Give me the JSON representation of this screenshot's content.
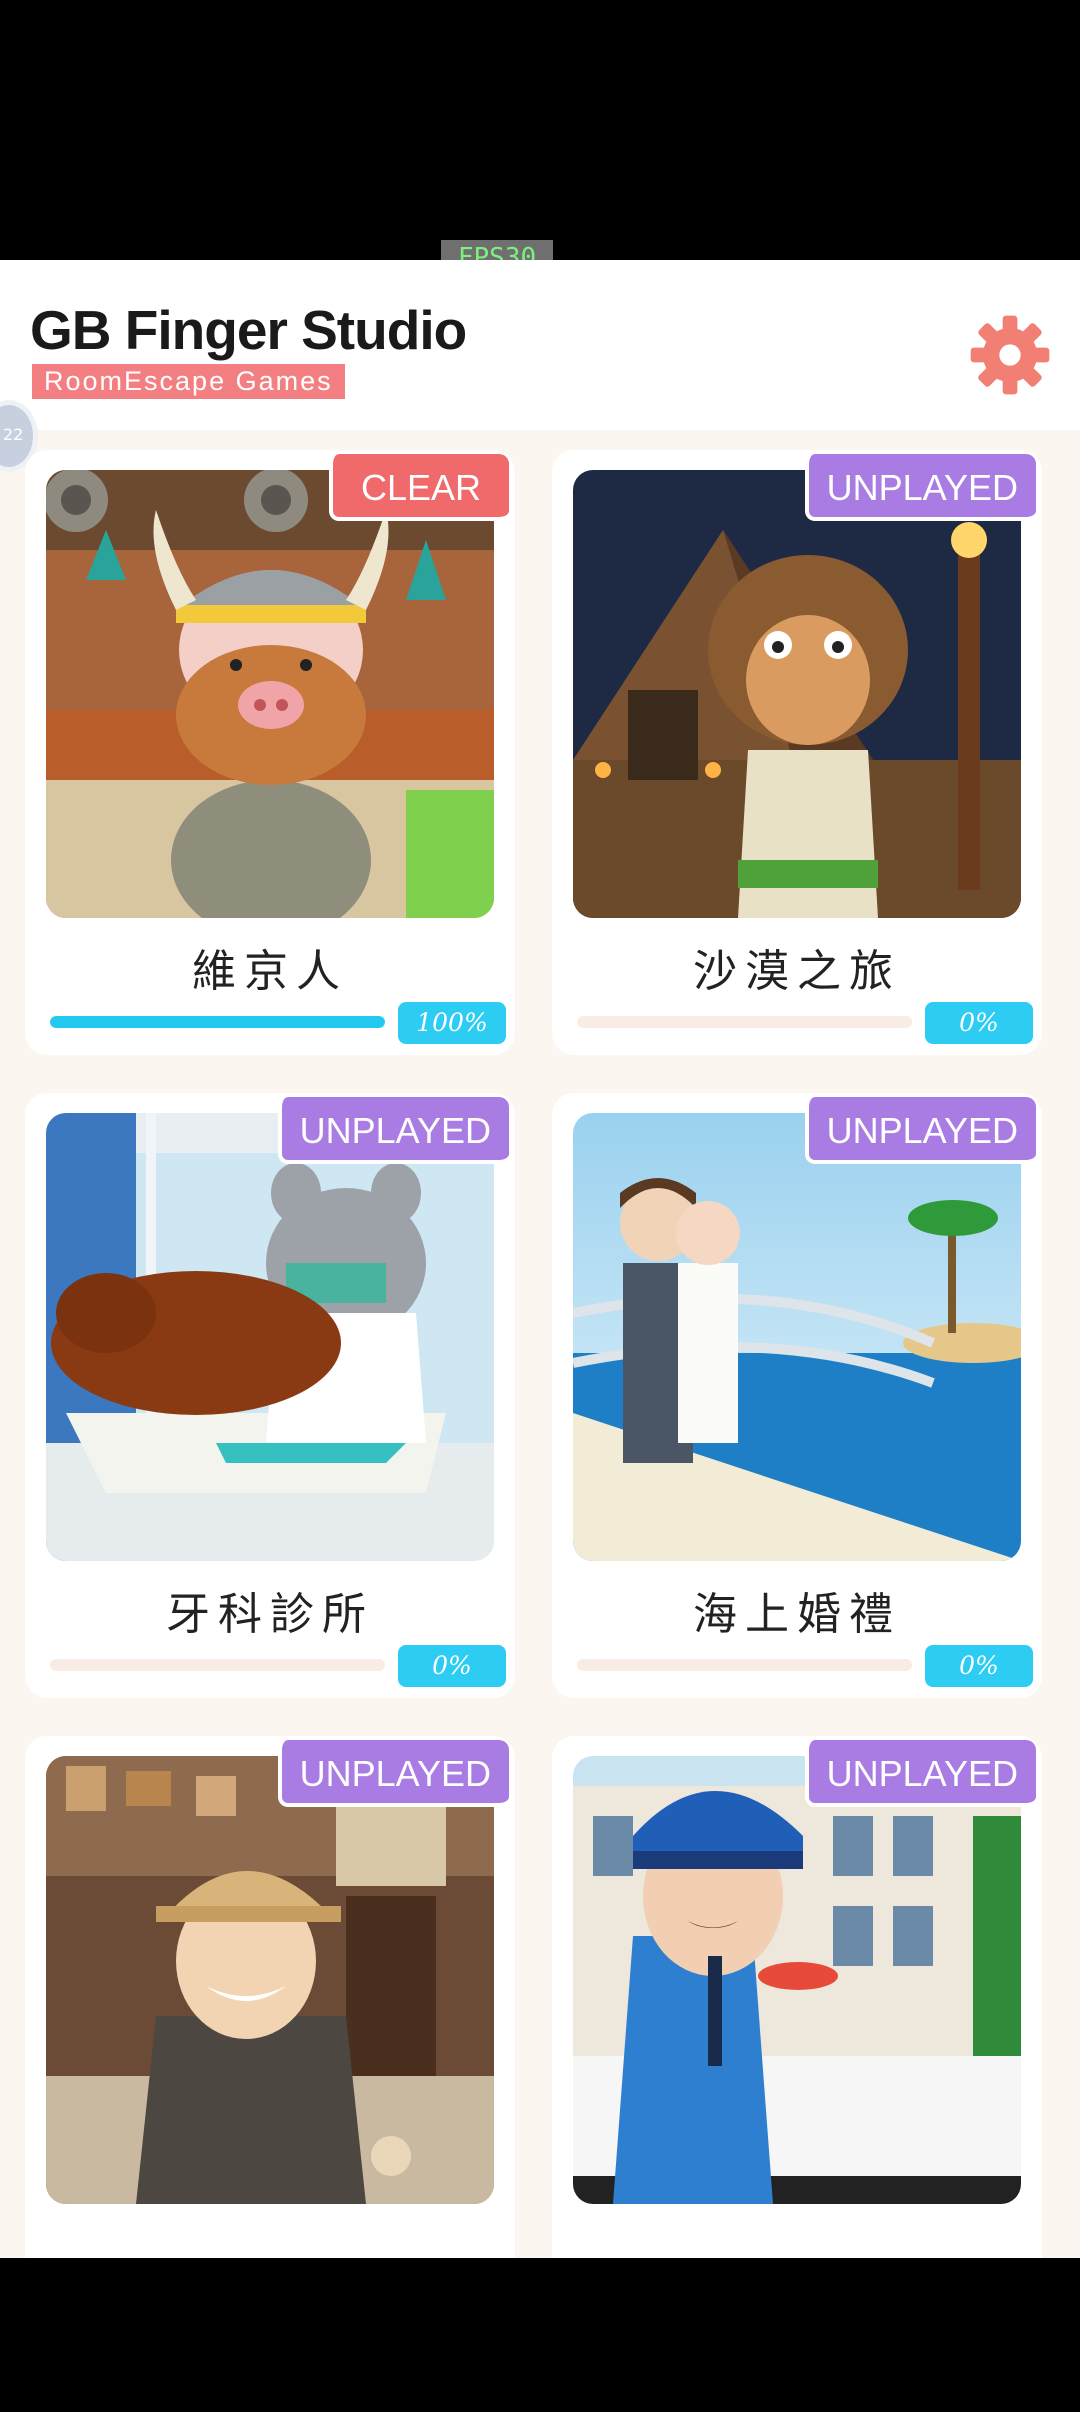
{
  "status_bar": {
    "fps": "FPS30"
  },
  "header": {
    "title": "GB Finger Studio",
    "subtitle": "RoomEscape Games",
    "settings_icon": "gear-icon",
    "accent_color": "#f47f82"
  },
  "edge_bubble": {
    "label": "22"
  },
  "games": [
    {
      "title": "維京人",
      "status": "CLEAR",
      "progress_percent": 100,
      "progress_label": "100%"
    },
    {
      "title": "沙漠之旅",
      "status": "UNPLAYED",
      "progress_percent": 0,
      "progress_label": "0%"
    },
    {
      "title": "牙科診所",
      "status": "UNPLAYED",
      "progress_percent": 0,
      "progress_label": "0%"
    },
    {
      "title": "海上婚禮",
      "status": "UNPLAYED",
      "progress_percent": 0,
      "progress_label": "0%"
    },
    {
      "title": "",
      "status": "UNPLAYED",
      "progress_percent": 0,
      "progress_label": ""
    },
    {
      "title": "",
      "status": "UNPLAYED",
      "progress_percent": 0,
      "progress_label": ""
    }
  ],
  "colors": {
    "clear_badge": "#f0696b",
    "unplayed_badge": "#a97ce4",
    "progress": "#22c8ef"
  }
}
